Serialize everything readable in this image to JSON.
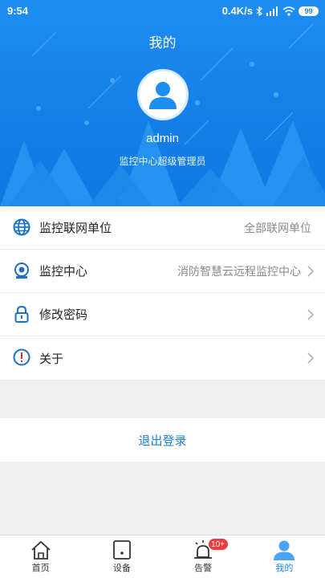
{
  "statusbar": {
    "time": "9:54",
    "speed": "0.4K/s",
    "battery": "99"
  },
  "header": {
    "title": "我的",
    "username": "admin",
    "role": "监控中心超级管理员"
  },
  "menu": {
    "items": [
      {
        "label": "监控联网单位",
        "value": "全部联网单位",
        "icon": "globe-icon"
      },
      {
        "label": "监控中心",
        "value": "消防智慧云远程监控中心",
        "icon": "camera-icon"
      },
      {
        "label": "修改密码",
        "value": "",
        "icon": "lock-icon"
      },
      {
        "label": "关于",
        "value": "",
        "icon": "info-icon"
      }
    ]
  },
  "logout_label": "退出登录",
  "tabbar": {
    "tabs": [
      {
        "label": "首页",
        "icon": "home-icon"
      },
      {
        "label": "设备",
        "icon": "device-icon"
      },
      {
        "label": "告警",
        "icon": "alarm-icon",
        "badge": "10+"
      },
      {
        "label": "我的",
        "icon": "user-icon"
      }
    ]
  },
  "colors": {
    "primary": "#1a86ec",
    "badge": "#f23b3b",
    "logout_text": "#1a7fd6"
  }
}
